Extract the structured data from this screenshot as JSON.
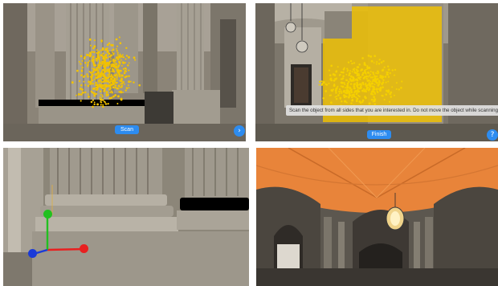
{
  "panels": {
    "scan": {
      "button_label": "Scan",
      "corner_icon": "circle-arrow-icon"
    },
    "finish": {
      "instruction": "Scan the object from all sides that you are interested in. Do not move the object while scanning!",
      "button_label": "Finish",
      "corner_icon": "info-icon"
    },
    "gizmo": {
      "axes": [
        "x-axis-red",
        "y-axis-green",
        "z-axis-blue"
      ]
    },
    "dome": {}
  },
  "colors": {
    "accent_blue": "#2d8cf0",
    "point_cloud": "#f2c200",
    "axis_red": "#e82020",
    "axis_green": "#22c020",
    "axis_blue": "#1a3ad8",
    "dome_orange": "#e8843a"
  }
}
